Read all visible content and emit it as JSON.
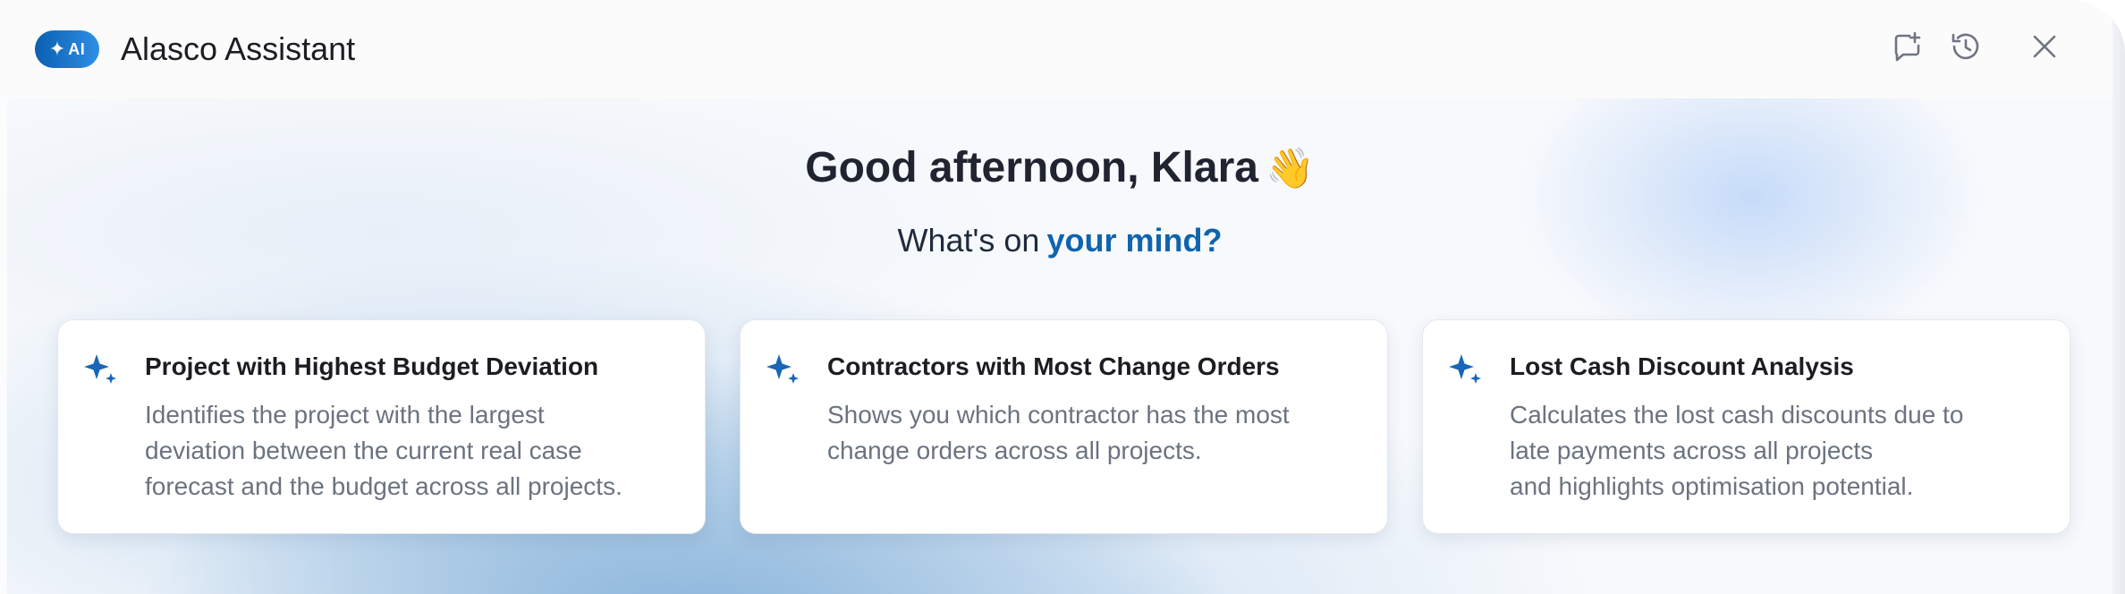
{
  "header": {
    "badge_label": "AI",
    "title": "Alasco Assistant",
    "actions": {
      "new_chat_icon": "chat-plus-icon",
      "history_icon": "history-icon",
      "close_icon": "close-icon"
    }
  },
  "hero": {
    "greeting": "Good afternoon, Klara",
    "greeting_emoji": "👋",
    "prompt_prefix": "What's on",
    "prompt_accent": "your mind?"
  },
  "colors": {
    "accent": "#0f64ad",
    "spark": "#1766b8"
  },
  "suggestions": [
    {
      "title": "Project with Highest Budget Deviation",
      "description": "Identifies the project with the largest\ndeviation between the current real case\nforecast and the budget across all projects."
    },
    {
      "title": "Contractors with Most Change Orders",
      "description": "Shows you which contractor has the most\nchange orders across all projects."
    },
    {
      "title": "Lost Cash Discount Analysis",
      "description": "Calculates the lost cash discounts due to\nlate payments across all projects\n and highlights optimisation potential."
    }
  ]
}
